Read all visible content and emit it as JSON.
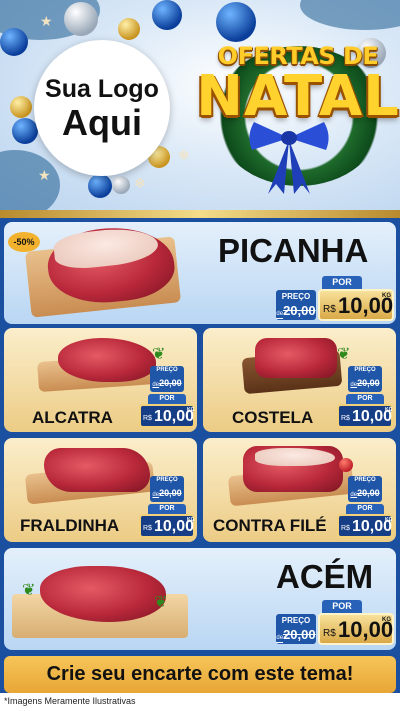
{
  "branding": {
    "logo_line1": "Sua Logo",
    "logo_line2": "Aqui",
    "title_top": "OFERTAS DE",
    "title_main": "NATAL"
  },
  "colors": {
    "primary_blue": "#1b4fa0",
    "gold": "#f2c65a",
    "title_yellow": "#ffd22e",
    "bow_blue": "#1f43c9"
  },
  "badge": {
    "discount": "-50%"
  },
  "price_labels": {
    "preco": "PREÇO",
    "por": "POR",
    "currency": "R$",
    "unit": "KG",
    "old_prefix": "de"
  },
  "products": [
    {
      "name": "PICANHA",
      "old_price": "20,00",
      "price": "10,00"
    },
    {
      "name": "ALCATRA",
      "old_price": "20,00",
      "price": "10,00"
    },
    {
      "name": "COSTELA",
      "old_price": "20,00",
      "price": "10,00"
    },
    {
      "name": "FRALDINHA",
      "old_price": "20,00",
      "price": "10,00"
    },
    {
      "name": "CONTRA FILÉ",
      "old_price": "20,00",
      "price": "10,00"
    },
    {
      "name": "ACÉM",
      "old_price": "20,00",
      "price": "10,00"
    }
  ],
  "cta": {
    "label": "Crie seu encarte com este tema!"
  },
  "footer": {
    "disclaimer": "*Imagens Meramente Ilustrativas"
  }
}
